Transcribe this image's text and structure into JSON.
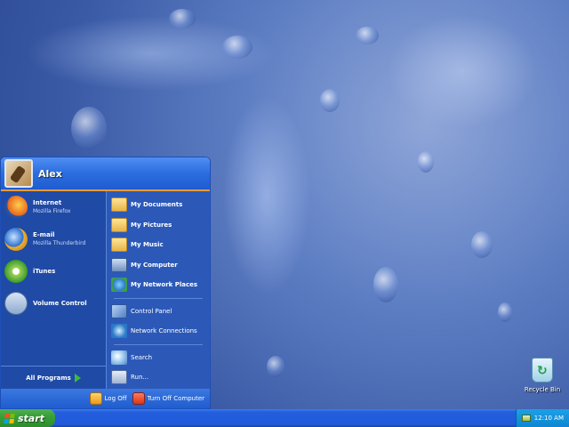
{
  "desktop": {
    "recycle_bin_label": "Recycle Bin"
  },
  "start_menu": {
    "user_name": "Alex",
    "pinned_programs": [
      {
        "name": "Internet",
        "subtitle": "Mozilla Firefox",
        "icon": "firefox-icon"
      },
      {
        "name": "E-mail",
        "subtitle": "Mozilla Thunderbird",
        "icon": "thunderbird-icon"
      }
    ],
    "recent_programs": [
      {
        "name": "iTunes",
        "icon": "itunes-icon"
      },
      {
        "name": "Volume Control",
        "icon": "volume-control-icon"
      }
    ],
    "all_programs_label": "All Programs",
    "places": [
      {
        "label": "My Documents",
        "icon": "folder-documents-icon"
      },
      {
        "label": "My Pictures",
        "icon": "folder-pictures-icon"
      },
      {
        "label": "My Music",
        "icon": "folder-music-icon"
      },
      {
        "label": "My Computer",
        "icon": "computer-icon"
      },
      {
        "label": "My Network Places",
        "icon": "network-places-icon"
      }
    ],
    "system": [
      {
        "label": "Control Panel",
        "icon": "control-panel-icon"
      },
      {
        "label": "Network Connections",
        "icon": "network-connections-icon"
      }
    ],
    "tools": [
      {
        "label": "Search",
        "icon": "search-icon"
      },
      {
        "label": "Run...",
        "icon": "run-icon"
      }
    ],
    "footer": {
      "log_off": "Log Off",
      "turn_off": "Turn Off Computer"
    }
  },
  "taskbar": {
    "start_label": "start",
    "clock": "12:10 AM"
  },
  "colors": {
    "start_green": "#38a038",
    "taskbar_blue": "#245edc",
    "menu_left": "#1f4aa6",
    "menu_right": "#2c59b8"
  }
}
